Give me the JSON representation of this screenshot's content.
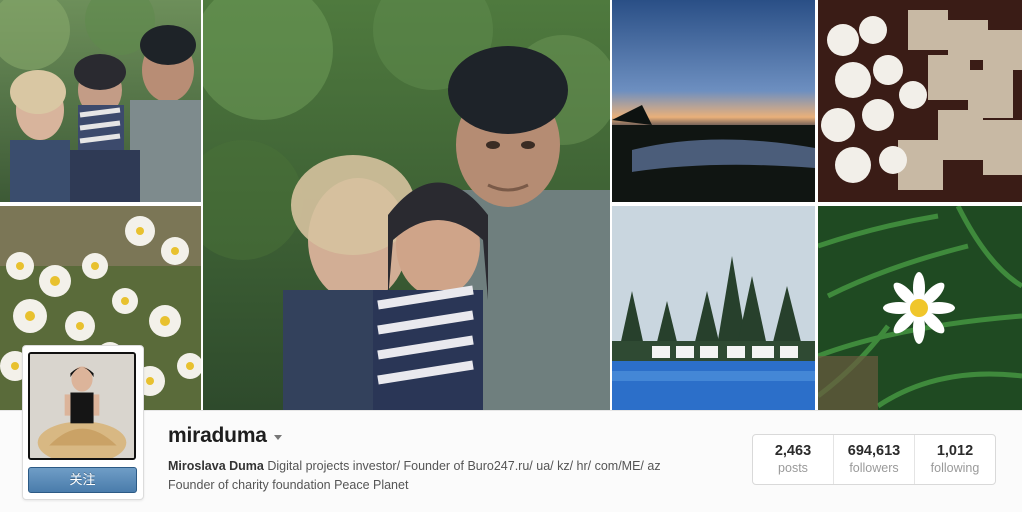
{
  "profile": {
    "username": "miraduma",
    "follow_button_label": "关注",
    "bio": {
      "full_name": "Miroslava Duma",
      "line1_text": "Digital projects investor/ Founder of Buro247.ru/ ua/ kz/ hr/ com/ME/ az",
      "line2_text": "Founder of charity foundation Peace Planet"
    }
  },
  "stats": [
    {
      "value": "2,463",
      "label": "posts"
    },
    {
      "value": "694,613",
      "label": "followers"
    },
    {
      "value": "1,012",
      "label": "following"
    }
  ],
  "colors": {
    "follow_button": "#4a7cab",
    "page_background": "#fbfbfb",
    "username_text": "#1e1e1e",
    "stat_label": "#9a9a9a"
  },
  "icons": {
    "dropdown": "caret-down-icon"
  }
}
